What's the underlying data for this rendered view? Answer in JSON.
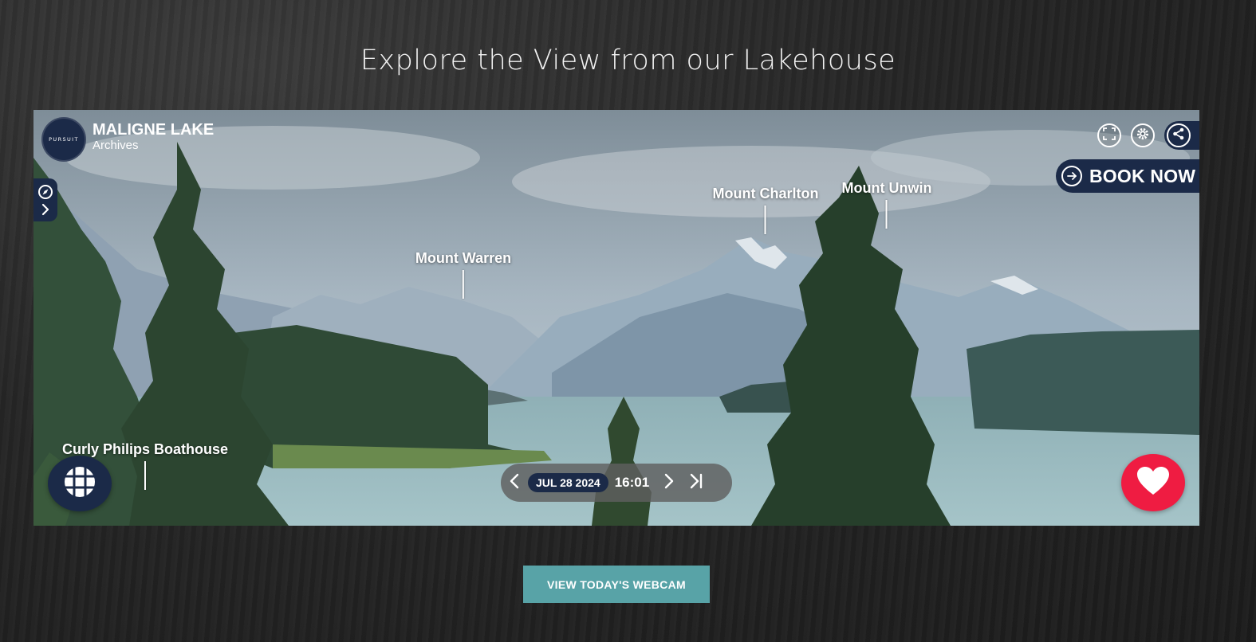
{
  "page": {
    "title": "Explore the View from our Lakehouse",
    "cta_label": "VIEW TODAY'S WEBCAM"
  },
  "viewer": {
    "brand_logo_text": "PURSUIT",
    "location_name": "MALIGNE LAKE",
    "location_sub": "Archives",
    "book_now_label": "BOOK NOW",
    "pois": [
      {
        "label": "Mount Warren"
      },
      {
        "label": "Mount Charlton"
      },
      {
        "label": "Mount Unwin"
      },
      {
        "label": "Curly Philips Boathouse"
      }
    ],
    "timebar": {
      "date": "JUL 28 2024",
      "time": "16:01"
    },
    "icons": {
      "fullscreen": "fullscreen-icon",
      "settings": "gear-icon",
      "share": "share-icon",
      "compass": "compass-icon",
      "grid": "grid-icon",
      "favorite": "heart-icon"
    }
  },
  "colors": {
    "navy": "#1b2a48",
    "favorite_red": "#ef1c42",
    "cta_teal": "#58a3a7"
  }
}
